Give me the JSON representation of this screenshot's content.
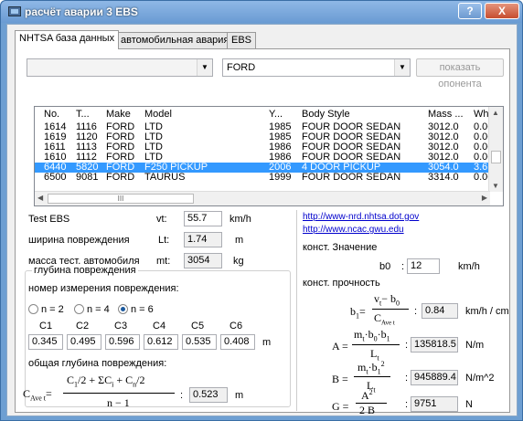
{
  "window": {
    "title": "расчёт аварии 3 EBS",
    "help_label": "?",
    "close_label": "X"
  },
  "tabs": [
    "NHTSA база данных",
    "автомобильная авария",
    "EBS"
  ],
  "filter": {
    "left_value": "",
    "make_value": "FORD",
    "button": "показать опонента"
  },
  "table": {
    "columns": [
      "No.",
      "T...",
      "Make",
      "Model",
      "Y...",
      "Body Style",
      "Mass ...",
      "Wh"
    ],
    "rows": [
      [
        "1614",
        "1116",
        "FORD",
        "LTD",
        "1985",
        "FOUR DOOR SEDAN",
        "3012.0",
        "0.0C"
      ],
      [
        "1619",
        "1120",
        "FORD",
        "LTD",
        "1985",
        "FOUR DOOR SEDAN",
        "3012.0",
        "0.0C"
      ],
      [
        "1611",
        "1113",
        "FORD",
        "LTD",
        "1986",
        "FOUR DOOR SEDAN",
        "3012.0",
        "0.0C"
      ],
      [
        "1610",
        "1112",
        "FORD",
        "LTD",
        "1986",
        "FOUR DOOR SEDAN",
        "3012.0",
        "0.0C"
      ],
      [
        "6440",
        "5820",
        "FORD",
        "F250 PICKUP",
        "2006",
        "4 DOOR PICKUP",
        "3054.0",
        "3.61"
      ],
      [
        "6500",
        "9081",
        "FORD",
        "TAURUS",
        "1999",
        "FOUR DOOR SEDAN",
        "3314.0",
        "0.0C"
      ]
    ],
    "selected_row": 4,
    "scroll_grip": "III"
  },
  "left": {
    "test_ebs": "Test EBS",
    "vt_label": "vt:",
    "vt_value": "55.7",
    "vt_unit": "km/h",
    "width_label": "ширина повреждения",
    "lt_label": "Lt:",
    "lt_value": "1.74",
    "lt_unit": "m",
    "mass_label": "масса тест. автомобиля",
    "mt_label": "mt:",
    "mt_value": "3054",
    "mt_unit": "kg",
    "group_title": "глубина повреждения",
    "num_label": "номер измерения повреждения:",
    "radios": [
      "n = 2",
      "n = 4",
      "n = 6"
    ],
    "radio_selected": 2,
    "c_labels": [
      "C1",
      "C2",
      "C3",
      "C4",
      "C5",
      "C6"
    ],
    "c_values": [
      "0.345",
      "0.495",
      "0.596",
      "0.612",
      "0.535",
      "0.408"
    ],
    "c_unit": "m",
    "total_label": "общая глубина повреждения:",
    "cavg_value": "0.523",
    "cavg_unit": "m"
  },
  "right": {
    "link1": "http://www-nrd.nhtsa.dot.gov",
    "link2": "http://www.ncac.gwu.edu",
    "const_value_label": "конст. Значение",
    "b0_label": "b0",
    "b0_value": "12",
    "b0_unit": "km/h",
    "const_strength_label": "конст. прочность",
    "b1_value": "0.84",
    "b1_unit": "km/h / cm",
    "A_value": "135818.5",
    "A_unit": "N/m",
    "B_value": "945889.4",
    "B_unit": "N/m^2",
    "G_value": "9751",
    "G_unit": "N"
  },
  "colors": {
    "accent": "#3399ff",
    "title_bar": "#6a9bd3",
    "link": "#0000cc"
  }
}
